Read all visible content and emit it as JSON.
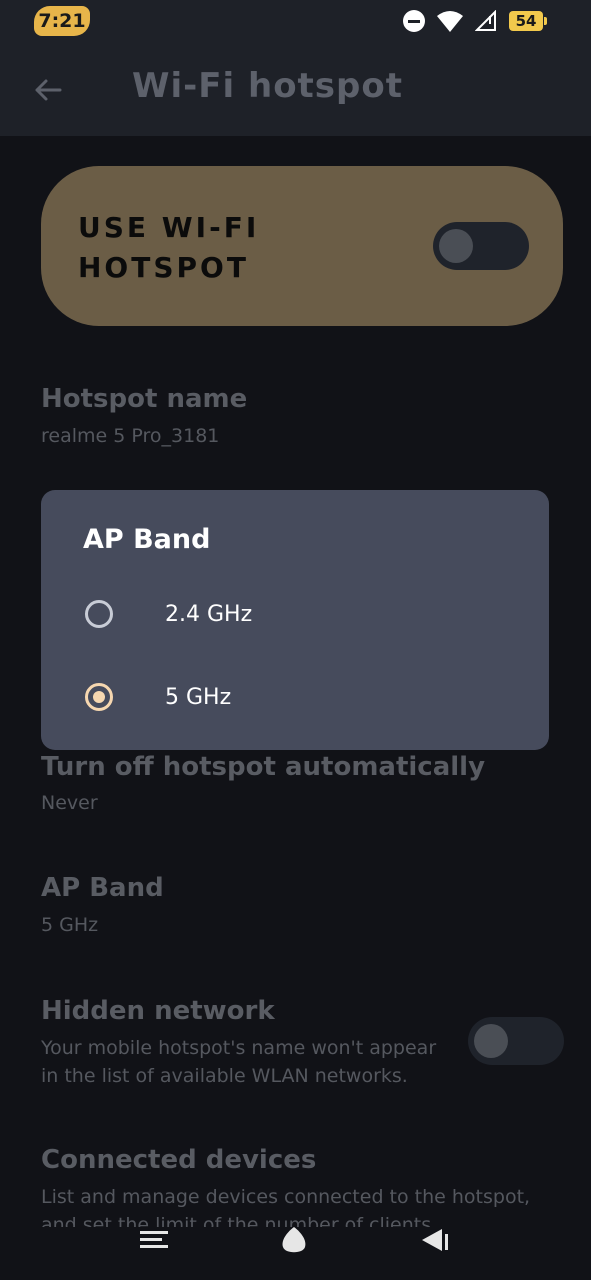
{
  "status_bar": {
    "time": "7:21",
    "battery": "54",
    "icons": [
      "do-not-disturb-icon",
      "wifi-icon",
      "signal-icon",
      "battery-icon"
    ]
  },
  "app_bar": {
    "title": "Wi-Fi hotspot",
    "back_icon": "back-arrow-icon"
  },
  "hotspot_toggle": {
    "label": "USE WI-FI HOTSPOT",
    "enabled": false
  },
  "rows": {
    "hotspot_name": {
      "title": "Hotspot name",
      "value": "realme 5 Pro_3181"
    },
    "turn_off": {
      "title": "Turn off hotspot automatically",
      "value": "Never"
    },
    "ap_band": {
      "title": "AP Band",
      "value": "5 GHz"
    },
    "hidden_network": {
      "title": "Hidden network",
      "description": "Your mobile hotspot's name won't appear in the list of available WLAN networks.",
      "enabled": false
    },
    "connected_devices": {
      "title": "Connected devices",
      "description": "List and manage devices connected to the hotspot, and set the limit of the number of clients"
    }
  },
  "dialog": {
    "title": "AP Band",
    "options": [
      {
        "label": "2.4 GHz",
        "selected": false
      },
      {
        "label": "5 GHz",
        "selected": true
      }
    ]
  },
  "nav": {
    "icons": [
      "menu-icon",
      "home-icon",
      "back-icon"
    ]
  },
  "colors": {
    "background": "#111217",
    "appbar": "#1e2128",
    "card": "#6b5d46",
    "dialog": "#464b5c",
    "accent": "#f6d7b0"
  }
}
